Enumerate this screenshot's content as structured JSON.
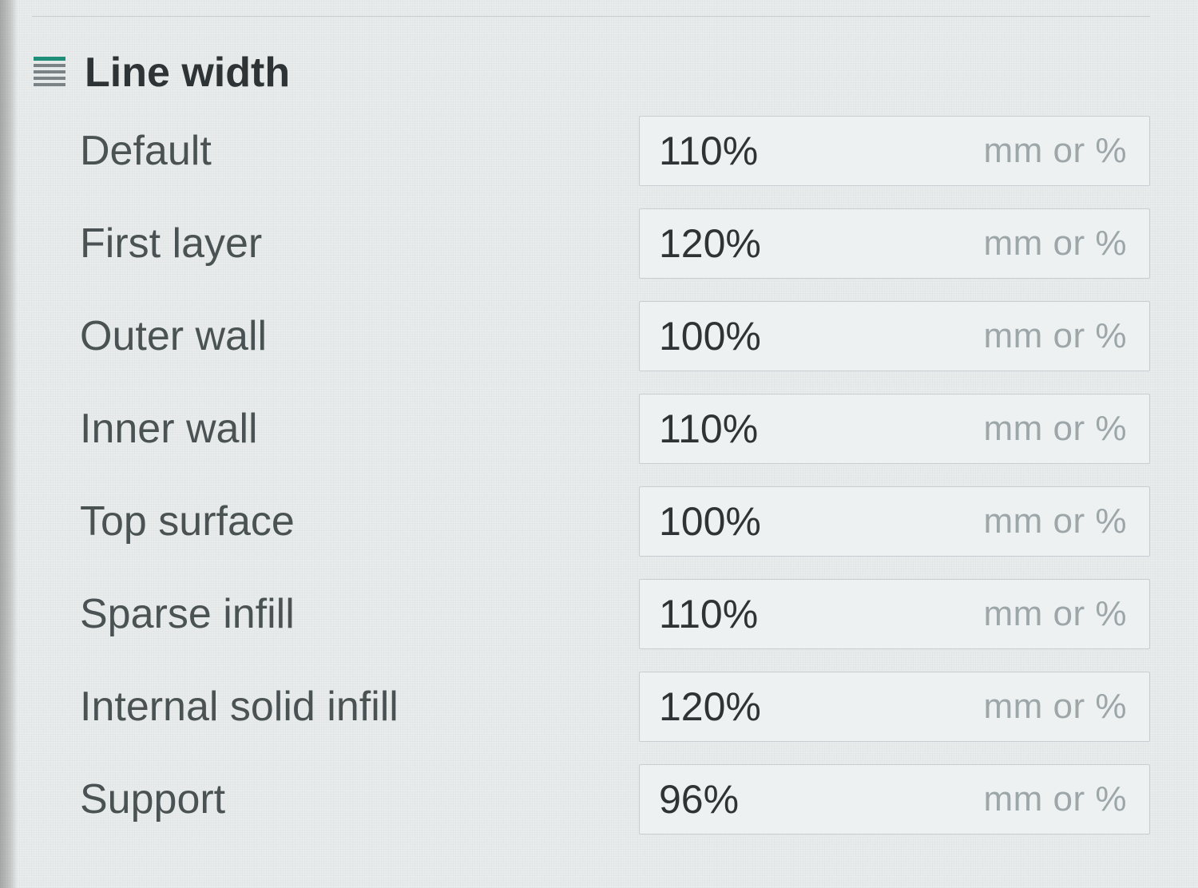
{
  "section": {
    "title": "Line width"
  },
  "unit_hint": "mm or %",
  "rows": [
    {
      "label": "Default",
      "value": "110%"
    },
    {
      "label": "First layer",
      "value": "120%"
    },
    {
      "label": "Outer wall",
      "value": "100%"
    },
    {
      "label": "Inner wall",
      "value": "110%"
    },
    {
      "label": "Top surface",
      "value": "100%"
    },
    {
      "label": "Sparse infill",
      "value": "110%"
    },
    {
      "label": "Internal solid infill",
      "value": "120%"
    },
    {
      "label": "Support",
      "value": "96%"
    }
  ]
}
